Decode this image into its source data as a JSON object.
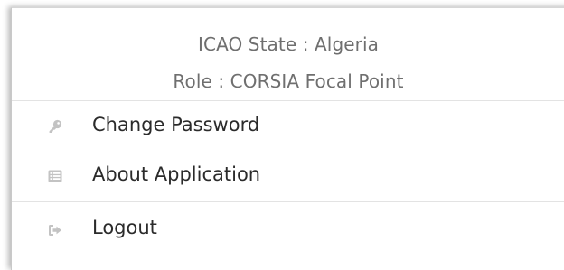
{
  "user": {
    "state_label": "ICAO State : Algeria",
    "role_label": "Role : CORSIA Focal Point"
  },
  "menu": {
    "items": [
      {
        "label": "Change Password",
        "icon": "key-icon"
      },
      {
        "label": "About Application",
        "icon": "list-icon"
      },
      {
        "label": "Logout",
        "icon": "sign-out-icon"
      }
    ]
  },
  "colors": {
    "icon": "#c3c3c3",
    "text": "#2b2b2b",
    "muted_text": "#6f6f6f",
    "divider": "#e3e3e3"
  }
}
